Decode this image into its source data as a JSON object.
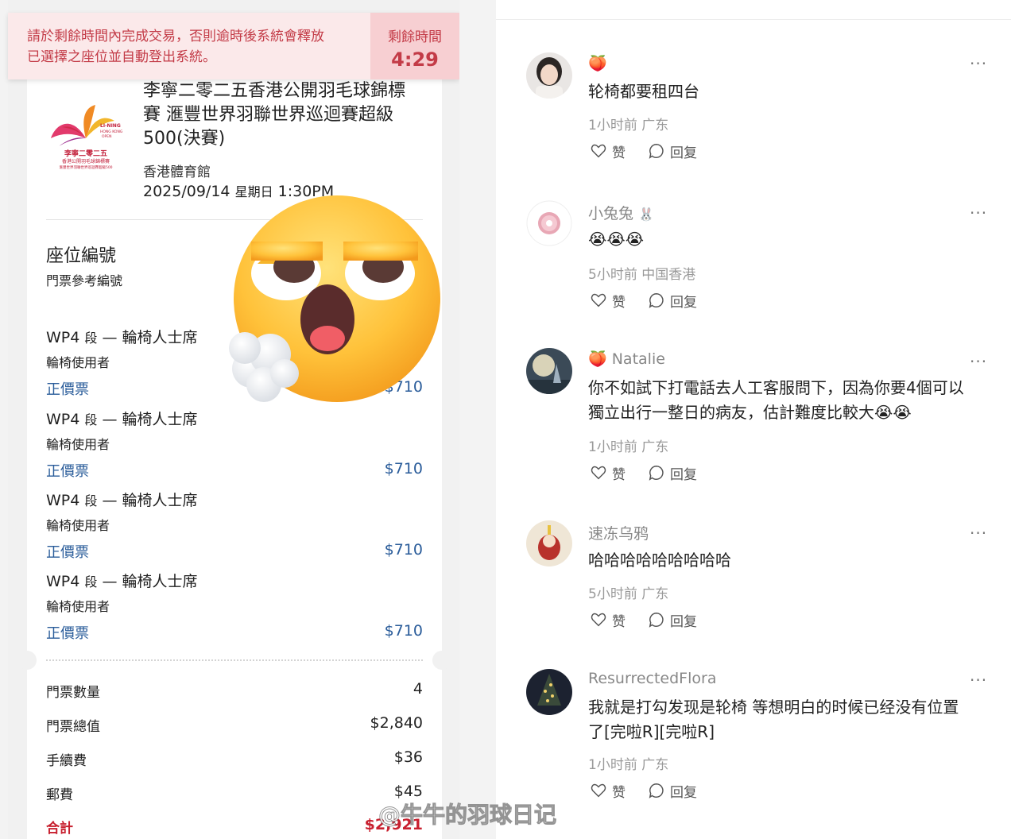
{
  "timer": {
    "message_line1": "請於剩餘時間內完成交易，否則逾時後系統會釋放",
    "message_line2": "已選擇之座位並自動登出系統。",
    "label": "剩餘時間",
    "value": "4:29"
  },
  "event": {
    "logo_text_line1": "李寧二零二五",
    "logo_text_line2": "香港公開羽毛球錦標賽",
    "logo_text_line3": "滙豐世界羽聯世界巡迴賽超級500",
    "title_line1": "李寧二零二五香港公開羽毛球錦標",
    "title_line2": "賽 滙豐世界羽聯世界巡迴賽超級",
    "title_line3": "500(決賽)",
    "venue": "香港體育館",
    "date": "2025/09/14",
    "weekday": "星期日",
    "time": "1:30PM"
  },
  "seats": {
    "title": "座位編號",
    "subtitle": "門票參考編號",
    "items": [
      {
        "section": "WP4",
        "seg": "段",
        "dash": "—",
        "area": "輪椅人士席",
        "user": "輪椅使用者",
        "type": "正價票",
        "price": "$710"
      },
      {
        "section": "WP4",
        "seg": "段",
        "dash": "—",
        "area": "輪椅人士席",
        "user": "輪椅使用者",
        "type": "正價票",
        "price": "$710"
      },
      {
        "section": "WP4",
        "seg": "段",
        "dash": "—",
        "area": "輪椅人士席",
        "user": "輪椅使用者",
        "type": "正價票",
        "price": "$710"
      },
      {
        "section": "WP4",
        "seg": "段",
        "dash": "—",
        "area": "輪椅人士席",
        "user": "輪椅使用者",
        "type": "正價票",
        "price": "$710"
      }
    ]
  },
  "summary": {
    "qty_label": "門票數量",
    "qty_value": "4",
    "subtotal_label": "門票總值",
    "subtotal_value": "$2,840",
    "fee_label": "手續費",
    "fee_value": "$36",
    "postage_label": "郵費",
    "postage_value": "$45",
    "total_label": "合計",
    "total_value": "$2,921"
  },
  "comments": [
    {
      "name": "",
      "text": "轮椅都要租四台",
      "time": "1小时前",
      "location": "广东",
      "like": "赞",
      "reply": "回复",
      "avatar": "girl-photo-avatar"
    },
    {
      "name": "小兔兔",
      "text": "",
      "time": "5小时前",
      "location": "中国香港",
      "like": "赞",
      "reply": "回复",
      "avatar": "donut-avatar"
    },
    {
      "name": "Natalie",
      "text_line1": "你不如試下打電話去人工客服問下，因為你要4個可以",
      "text_line2": "獨立出行一整日的病友，估計難度比較大",
      "time": "1小时前",
      "location": "广东",
      "like": "赞",
      "reply": "回复",
      "avatar": "moon-landscape-avatar"
    },
    {
      "name": "速冻乌鸦",
      "text": "哈哈哈哈哈哈哈哈哈",
      "time": "5小时前",
      "location": "广东",
      "like": "赞",
      "reply": "回复",
      "avatar": "figurine-avatar"
    },
    {
      "name": "ResurrectedFlora",
      "text_line1": "我就是打勾发现是轮椅 等想明白的时候已经没有位置",
      "text_line2": "了[完啦R][完啦R]",
      "time": "1小时前",
      "location": "广东",
      "like": "赞",
      "reply": "回复",
      "avatar": "christmas-tree-avatar"
    }
  ],
  "more_label": "···",
  "watermark": "@牛牛的羽球日记",
  "colors": {
    "timer_red": "#c33b47",
    "price_blue": "#2a5c9a",
    "total_red": "#c8202f"
  }
}
